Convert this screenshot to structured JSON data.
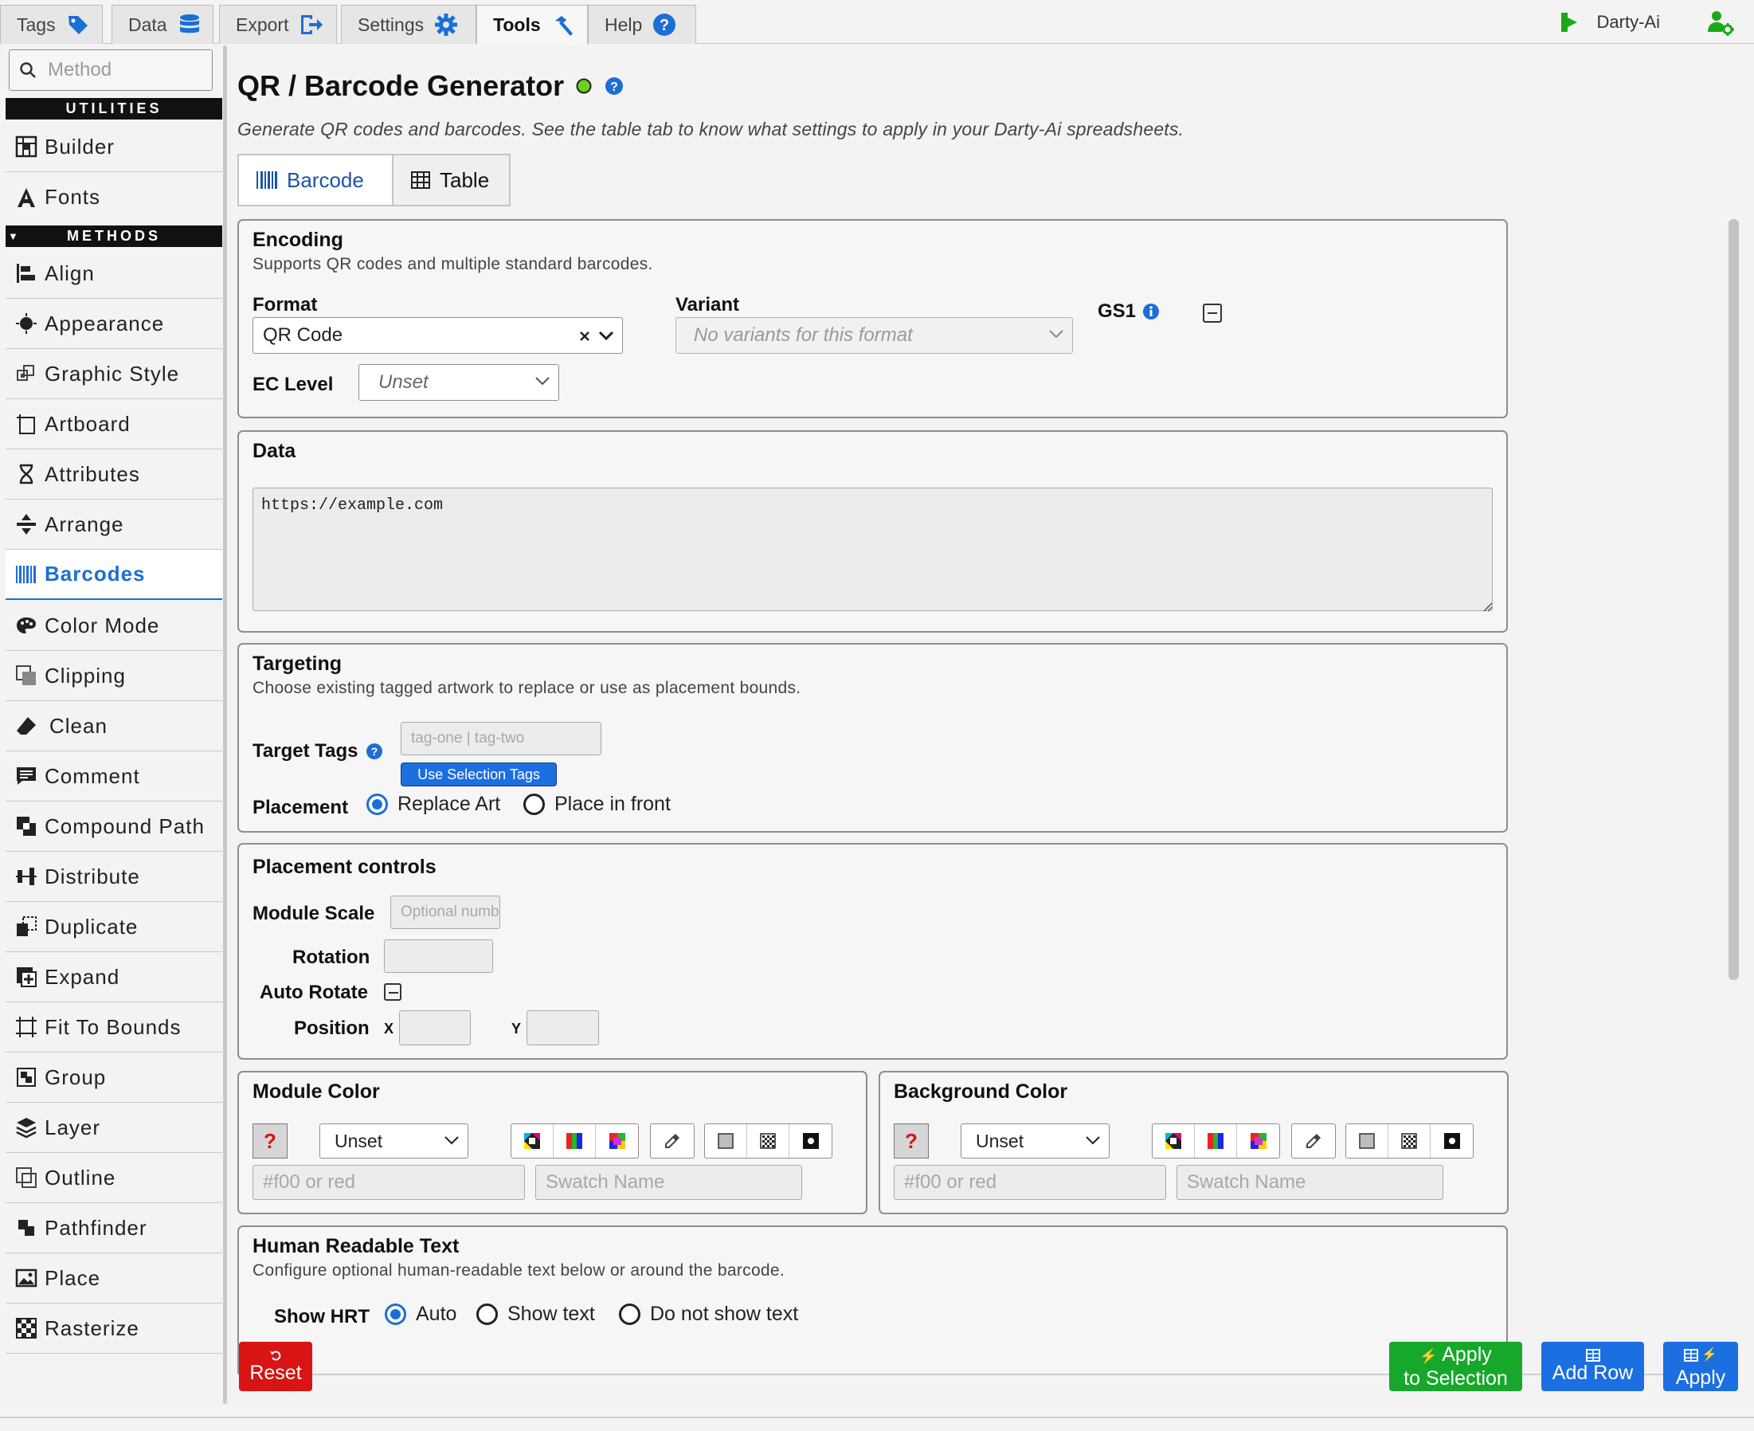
{
  "top_tabs": [
    {
      "label": "Tags",
      "icon": "tag-icon"
    },
    {
      "label": "Data",
      "icon": "database-icon"
    },
    {
      "label": "Export",
      "icon": "export-icon"
    },
    {
      "label": "Settings",
      "icon": "gear-icon"
    },
    {
      "label": "Tools",
      "icon": "hammer-icon",
      "active": true
    },
    {
      "label": "Help",
      "icon": "help-circle-icon"
    }
  ],
  "brand": {
    "name": "Darty-Ai"
  },
  "sidebar": {
    "search_placeholder": "Method",
    "utilities_header": "UTILITIES",
    "methods_header": "METHODS",
    "utilities": [
      {
        "label": "Builder",
        "icon": "builder-icon"
      },
      {
        "label": "Fonts",
        "icon": "font-icon"
      }
    ],
    "methods": [
      {
        "label": "Align",
        "icon": "align-icon"
      },
      {
        "label": "Appearance",
        "icon": "appearance-icon"
      },
      {
        "label": "Graphic Style",
        "icon": "graphic-style-icon"
      },
      {
        "label": "Artboard",
        "icon": "artboard-icon"
      },
      {
        "label": "Attributes",
        "icon": "attributes-icon"
      },
      {
        "label": "Arrange",
        "icon": "arrange-icon"
      },
      {
        "label": "Barcodes",
        "icon": "barcode-icon",
        "active": true
      },
      {
        "label": "Color Mode",
        "icon": "palette-icon"
      },
      {
        "label": "Clipping",
        "icon": "clipping-icon"
      },
      {
        "label": "Clean",
        "icon": "eraser-icon"
      },
      {
        "label": "Comment",
        "icon": "comment-icon"
      },
      {
        "label": "Compound Path",
        "icon": "compound-path-icon"
      },
      {
        "label": "Distribute",
        "icon": "distribute-icon"
      },
      {
        "label": "Duplicate",
        "icon": "duplicate-icon"
      },
      {
        "label": "Expand",
        "icon": "expand-icon"
      },
      {
        "label": "Fit To Bounds",
        "icon": "fit-to-bounds-icon"
      },
      {
        "label": "Group",
        "icon": "group-icon"
      },
      {
        "label": "Layer",
        "icon": "layers-icon"
      },
      {
        "label": "Outline",
        "icon": "outline-icon"
      },
      {
        "label": "Pathfinder",
        "icon": "pathfinder-icon"
      },
      {
        "label": "Place",
        "icon": "image-icon"
      },
      {
        "label": "Rasterize",
        "icon": "rasterize-icon"
      }
    ]
  },
  "page": {
    "title": "QR / Barcode Generator",
    "status_color": "#6bd11b",
    "description": "Generate QR codes and barcodes. See the table tab to know what settings to apply in your Darty-Ai spreadsheets."
  },
  "sub_tabs": [
    {
      "label": "Barcode",
      "icon": "barcode-icon",
      "active": true
    },
    {
      "label": "Table",
      "icon": "table-icon"
    }
  ],
  "encoding": {
    "title": "Encoding",
    "subtitle": "Supports QR codes and multiple standard barcodes.",
    "format_label": "Format",
    "format_value": "QR Code",
    "variant_label": "Variant",
    "variant_placeholder": "No variants for this format",
    "gs1_label": "GS1",
    "ec_label": "EC Level",
    "ec_value": "Unset"
  },
  "data_section": {
    "title": "Data",
    "value": "https://example.com"
  },
  "targeting": {
    "title": "Targeting",
    "subtitle": "Choose existing tagged artwork to replace or use as placement bounds.",
    "target_tags_label": "Target Tags",
    "target_tags_placeholder": "tag-one | tag-two",
    "use_selection_label": "Use Selection Tags",
    "placement_label": "Placement",
    "placement_options": [
      "Replace Art",
      "Place in front"
    ],
    "placement_selected": "Replace Art"
  },
  "placement_controls": {
    "title": "Placement controls",
    "module_scale_label": "Module Scale",
    "module_scale_placeholder": "Optional number",
    "rotation_label": "Rotation",
    "auto_rotate_label": "Auto Rotate",
    "position_label": "Position",
    "x_label": "X",
    "y_label": "Y"
  },
  "module_color": {
    "title": "Module Color",
    "mode": "Unset",
    "hex_placeholder": "#f00 or red",
    "swatch_placeholder": "Swatch Name"
  },
  "background_color": {
    "title": "Background Color",
    "mode": "Unset",
    "hex_placeholder": "#f00 or red",
    "swatch_placeholder": "Swatch Name"
  },
  "hrt": {
    "title": "Human Readable Text",
    "subtitle": "Configure optional human-readable text below or around the barcode.",
    "show_label": "Show HRT",
    "options": [
      "Auto",
      "Show text",
      "Do not show text"
    ],
    "selected": "Auto"
  },
  "footer": {
    "reset_label": "Reset",
    "apply_selection_line1": "Apply",
    "apply_selection_line2": "to Selection",
    "add_row_label": "Add Row",
    "apply_label": "Apply",
    "colors": {
      "reset": "#d81414",
      "apply_selection": "#16a82a",
      "add_row": "#1b6fe0",
      "apply": "#1b6fe0"
    }
  }
}
